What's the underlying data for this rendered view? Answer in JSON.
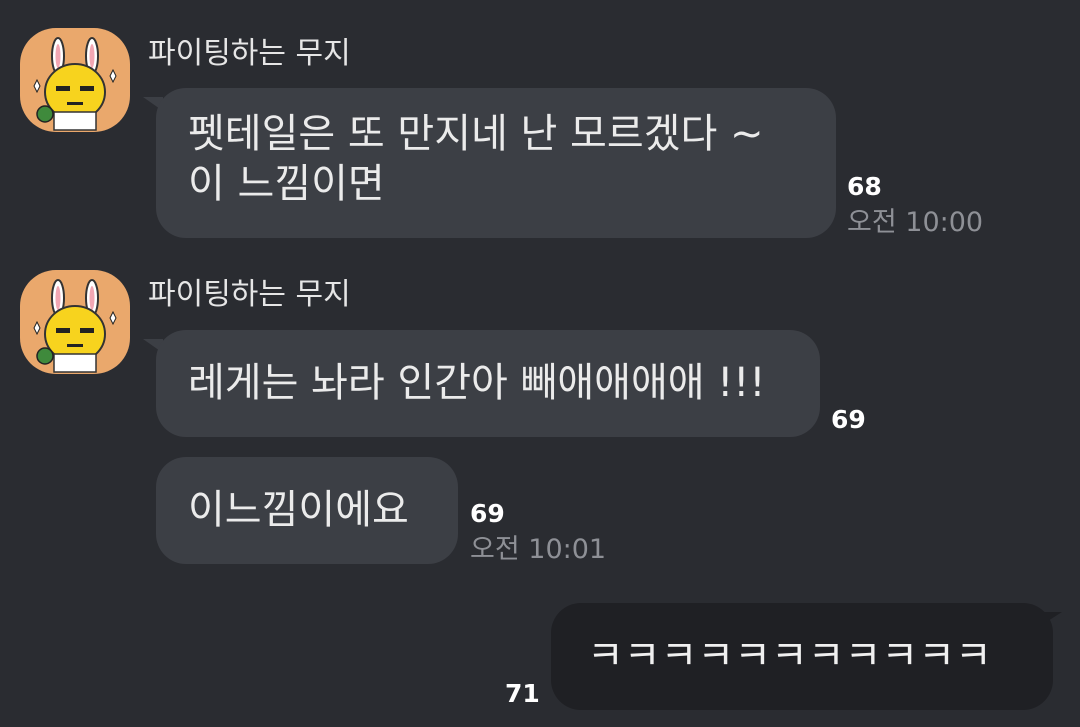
{
  "messages": [
    {
      "sender": "파이팅하는 무지",
      "line1": "펫테일은 또 만지네 난 모르겠다 ~",
      "line2": "이 느낌이면",
      "unread": "68",
      "time": "오전 10:00"
    },
    {
      "sender": "파이팅하는 무지",
      "text": "레게는 놔라 인간아 빼애애애애 !!!",
      "unread": "69"
    },
    {
      "text": "이느낌이에요",
      "unread": "69",
      "time": "오전 10:01"
    }
  ],
  "my_message": {
    "text": "ㅋㅋㅋㅋㅋㅋㅋㅋㅋㅋㅋ",
    "unread": "71"
  },
  "colors": {
    "background": "#2a2c31",
    "bubble_other": "#3c3f45",
    "bubble_mine": "#1f2024",
    "avatar_bg": "#eaa86c"
  },
  "avatar_icon": "muzi-character-icon"
}
